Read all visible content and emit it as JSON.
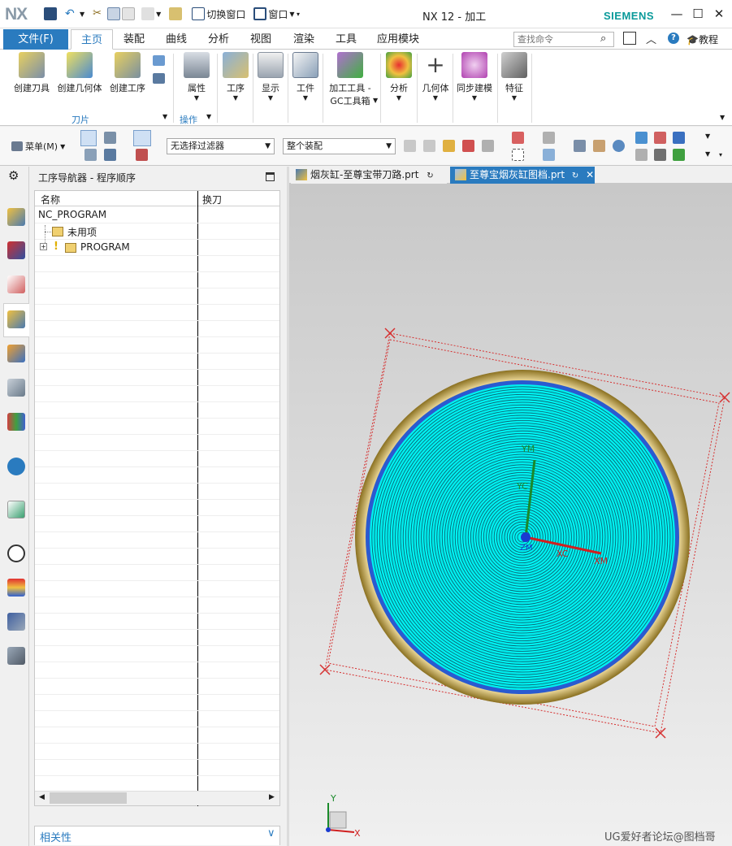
{
  "app": {
    "logo": "NX",
    "title": "NX 12 - 加工",
    "brand": "SIEMENS",
    "switch_window": "切换窗口",
    "window_menu": "窗口"
  },
  "ribbon": {
    "file_tab": "文件(F)",
    "tabs": [
      "主页",
      "装配",
      "曲线",
      "分析",
      "视图",
      "渲染",
      "工具",
      "应用模块"
    ],
    "search_placeholder": "查找命令",
    "tutorial": "教程",
    "buttons": {
      "create_tool": "创建刀具",
      "create_geometry": "创建几何体",
      "create_operation": "创建工序",
      "properties": "属性",
      "operation": "工序",
      "display": "显示",
      "workpiece": "工件",
      "machining_tools": "加工工具 -",
      "gc_toolbox": "GC工具箱",
      "analysis": "分析",
      "geometry": "几何体",
      "sync_modeling": "同步建模",
      "feature": "特征"
    },
    "groups": {
      "insert": "刀片",
      "actions": "操作"
    }
  },
  "toolbar2": {
    "menu": "菜单(M)",
    "filter": "无选择过滤器",
    "assembly_scope": "整个装配"
  },
  "navigator": {
    "title": "工序导航器 - 程序顺序",
    "col_name": "名称",
    "col_tool_change": "换刀",
    "root": "NC_PROGRAM",
    "unused": "未用项",
    "program": "PROGRAM",
    "footer": "相关性"
  },
  "viewport": {
    "tabs": [
      "烟灰缸-至尊宝带刀路.prt",
      "至尊宝烟灰缸图档.prt"
    ],
    "labels": {
      "ym": "YM",
      "yc": "YC",
      "xc": "XC",
      "xm": "XM",
      "zm": "ZM",
      "triad_x": "X",
      "triad_y": "Y"
    },
    "watermark": "UG爱好者论坛@图档哥"
  },
  "colors": {
    "accent": "#2a7bbf",
    "toolpath": "#00f0f0",
    "rim": "#b8a04a",
    "bbox": "#d63030"
  }
}
